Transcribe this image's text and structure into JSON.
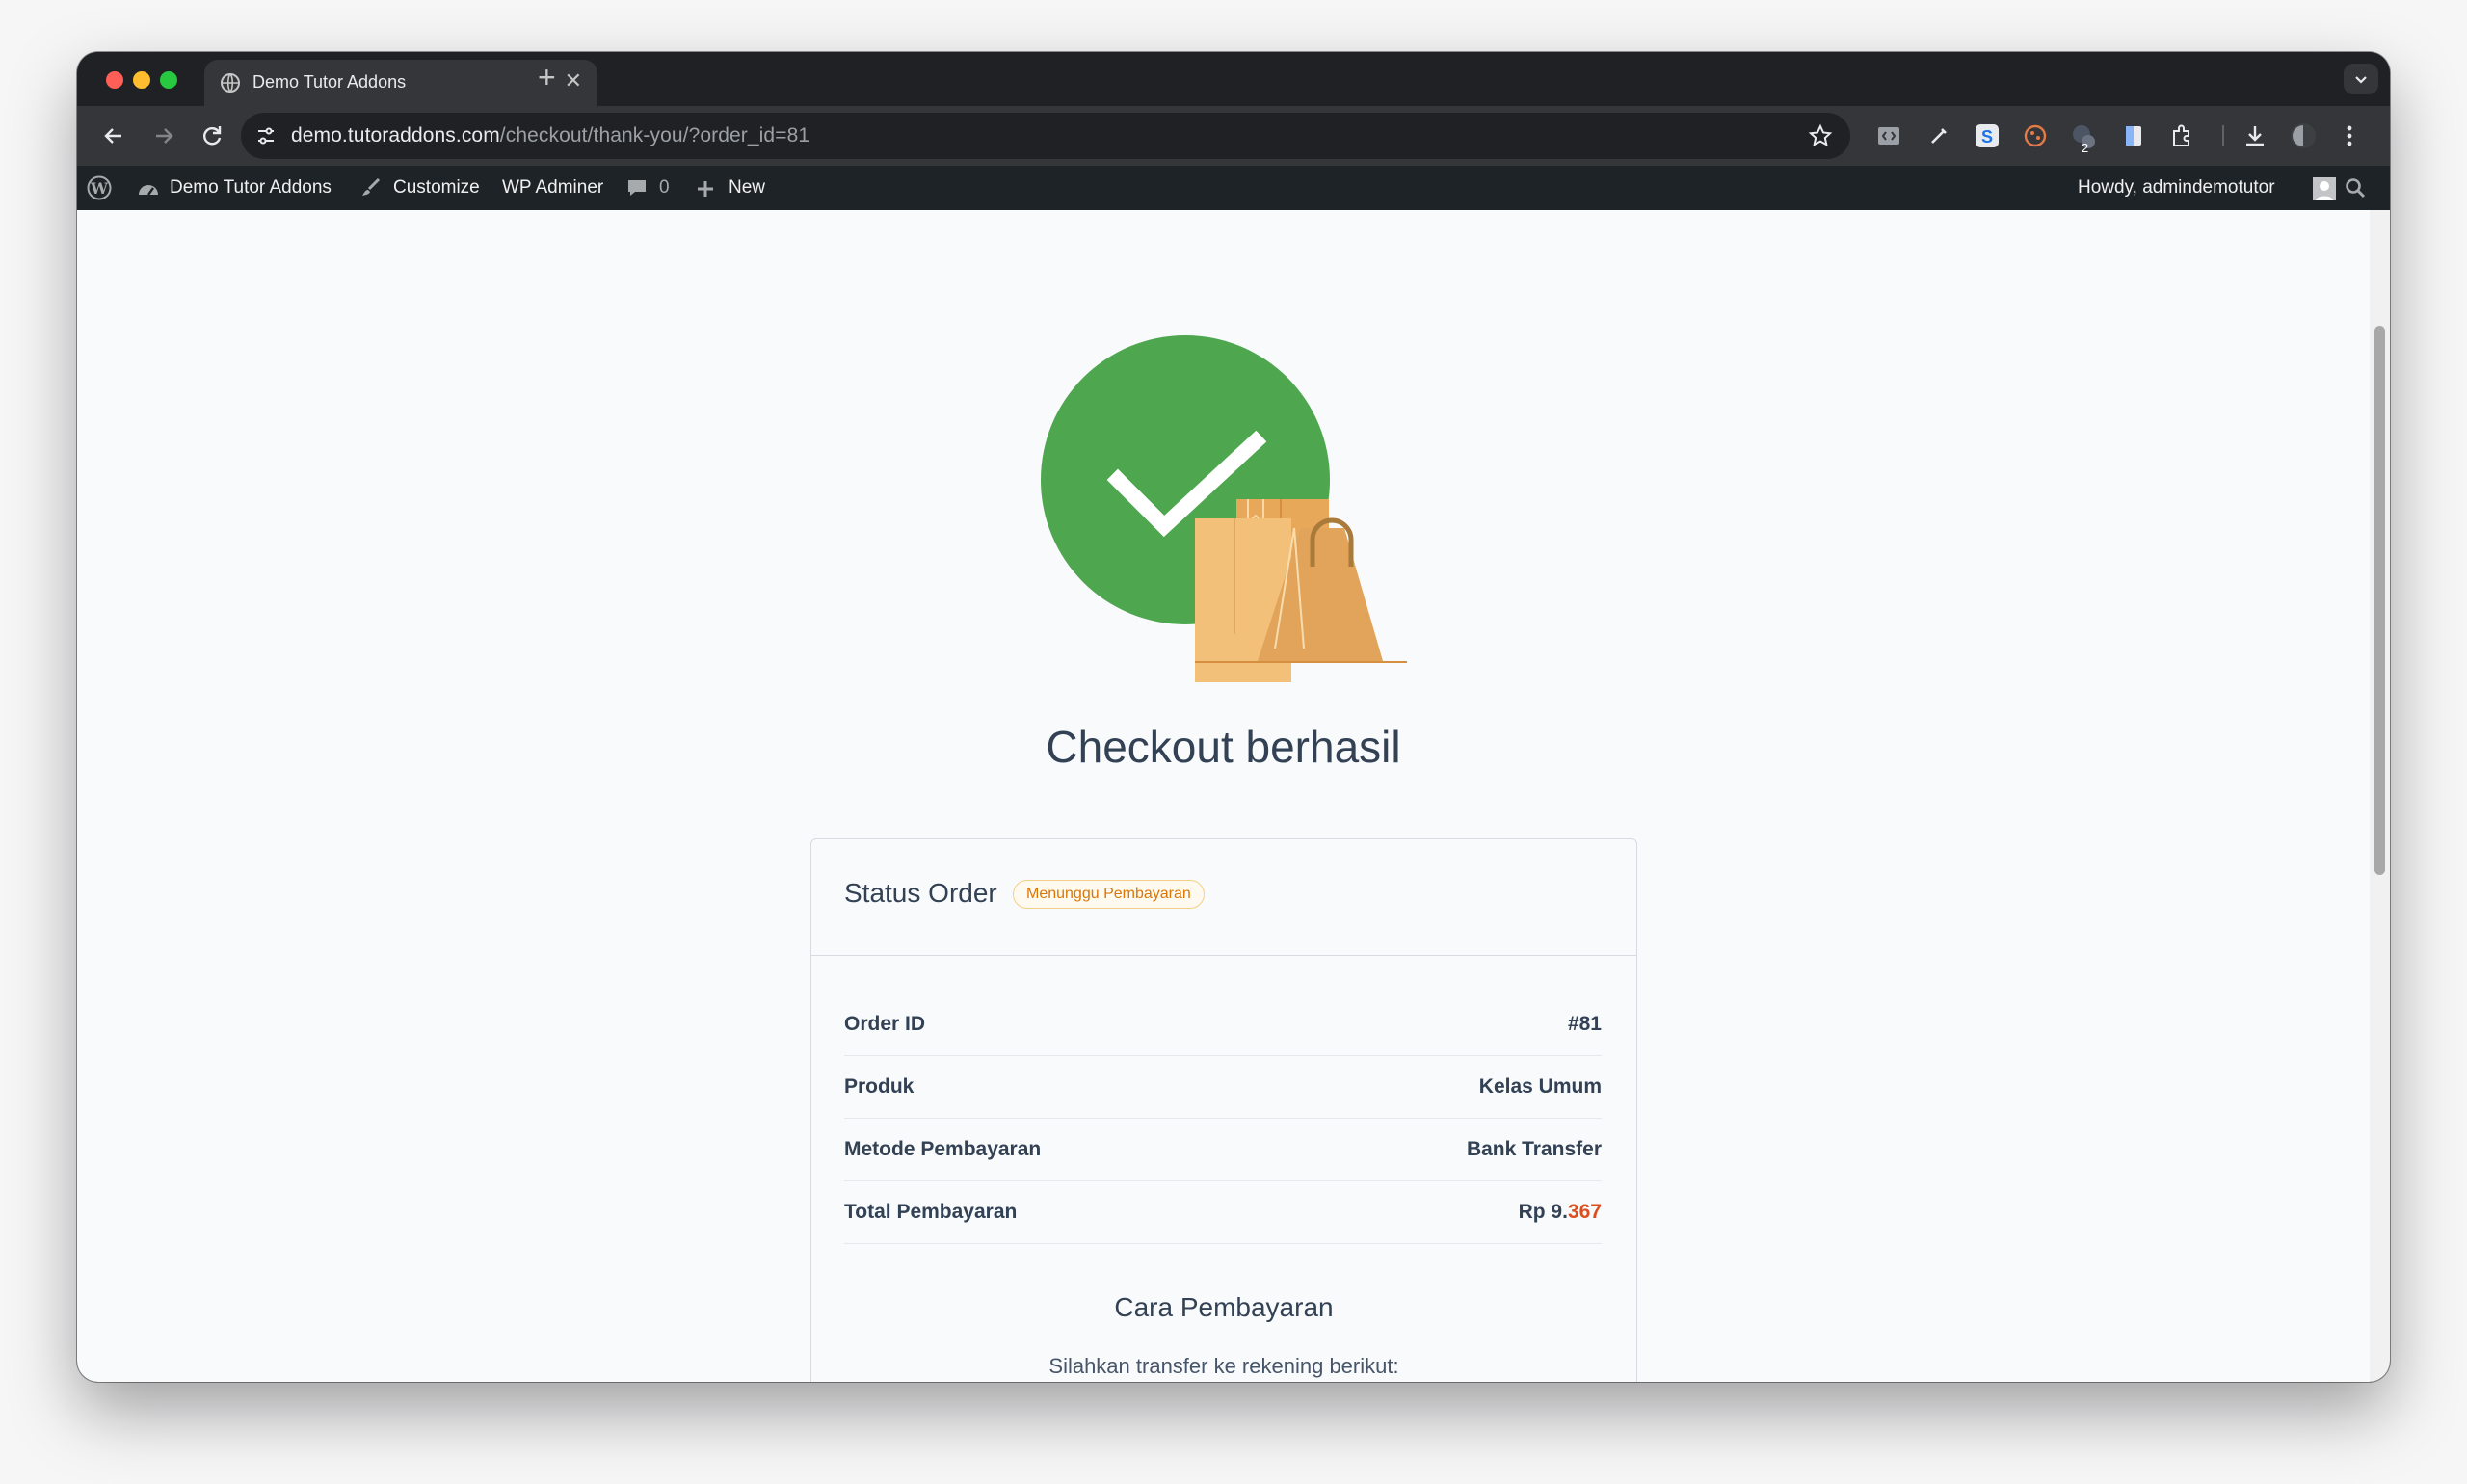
{
  "browser": {
    "tab_title": "Demo Tutor Addons",
    "url_host": "demo.tutoraddons.com",
    "url_path": "/checkout/thank-you/?order_id=81",
    "extension_badge": "2"
  },
  "wp_admin_bar": {
    "site_name": "Demo Tutor Addons",
    "customize": "Customize",
    "wp_adminer": "WP Adminer",
    "comments_count": "0",
    "new": "New",
    "greeting": "Howdy, admindemotutor"
  },
  "page": {
    "title": "Checkout berhasil",
    "status_label": "Status Order",
    "status_badge": "Menunggu Pembayaran",
    "rows": [
      {
        "label": "Order ID",
        "value": "#81"
      },
      {
        "label": "Produk",
        "value": "Kelas Umum"
      },
      {
        "label": "Metode Pembayaran",
        "value": "Bank Transfer"
      },
      {
        "label": "Total Pembayaran",
        "value_main": "Rp 9.",
        "value_accent": "367"
      }
    ],
    "payment_title": "Cara Pembayaran",
    "payment_text": "Silahkan transfer ke rekening berikut:"
  },
  "colors": {
    "success": "#4ea74f",
    "accent": "#dc4d1f",
    "badge": "#d97706",
    "wp_bar": "#1d2327"
  }
}
